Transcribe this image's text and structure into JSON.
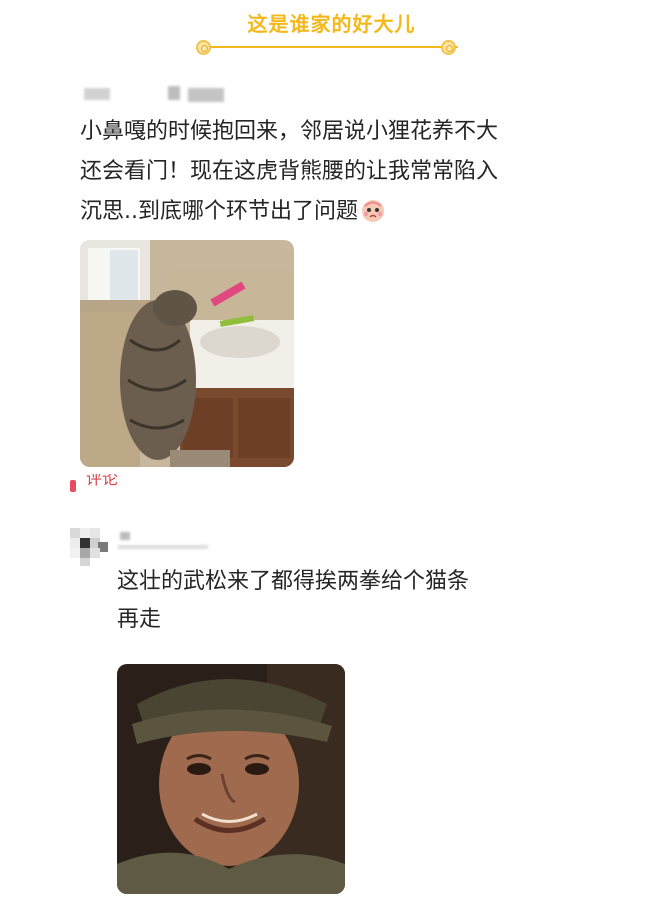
{
  "header": {
    "title": "这是谁家的好大儿",
    "accent_color": "#f5b81c",
    "coin_icon": "coin-icon"
  },
  "post": {
    "lines": [
      "小鼻嘎的时候抱回来，邻居说小狸花养不大",
      "还会看门！现在这虎背熊腰的让我常常陷入",
      "沉思..到底哪个环节出了问题"
    ],
    "emoji": "pleading-face-emoji",
    "image": "cat-at-sink-photo"
  },
  "comment_strip": {
    "label": "评论"
  },
  "comment": {
    "lines": [
      "这壮的武松来了都得挨两拳给个猫条",
      "再走"
    ],
    "image": "smiling-man-meme"
  }
}
